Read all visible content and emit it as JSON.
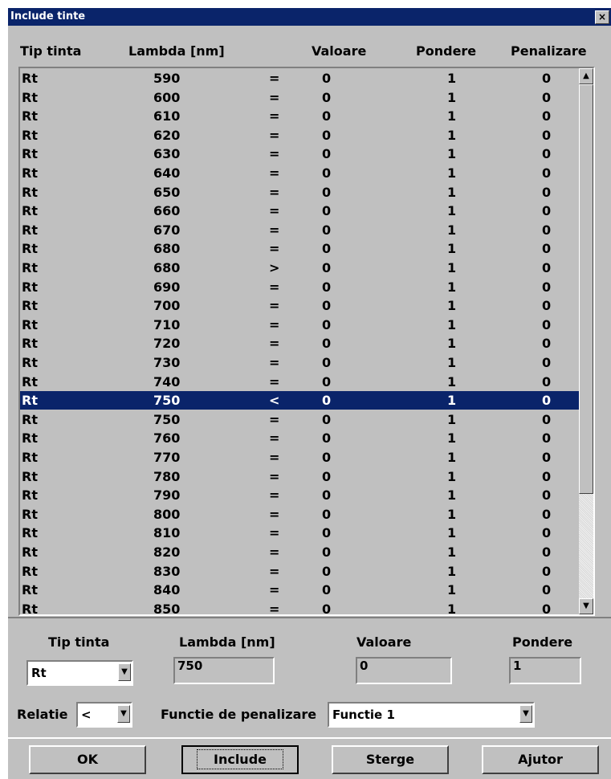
{
  "window": {
    "title": "Include tinte",
    "close_glyph": "×"
  },
  "table": {
    "headers": [
      "Tip tinta",
      "Lambda [nm]",
      "Valoare",
      "Pondere",
      "Penalizare"
    ],
    "rows": [
      [
        "Rt",
        "590",
        "=",
        "0",
        "1",
        "0"
      ],
      [
        "Rt",
        "600",
        "=",
        "0",
        "1",
        "0"
      ],
      [
        "Rt",
        "610",
        "=",
        "0",
        "1",
        "0"
      ],
      [
        "Rt",
        "620",
        "=",
        "0",
        "1",
        "0"
      ],
      [
        "Rt",
        "630",
        "=",
        "0",
        "1",
        "0"
      ],
      [
        "Rt",
        "640",
        "=",
        "0",
        "1",
        "0"
      ],
      [
        "Rt",
        "650",
        "=",
        "0",
        "1",
        "0"
      ],
      [
        "Rt",
        "660",
        "=",
        "0",
        "1",
        "0"
      ],
      [
        "Rt",
        "670",
        "=",
        "0",
        "1",
        "0"
      ],
      [
        "Rt",
        "680",
        "=",
        "0",
        "1",
        "0"
      ],
      [
        "Rt",
        "680",
        ">",
        "0",
        "1",
        "0"
      ],
      [
        "Rt",
        "690",
        "=",
        "0",
        "1",
        "0"
      ],
      [
        "Rt",
        "700",
        "=",
        "0",
        "1",
        "0"
      ],
      [
        "Rt",
        "710",
        "=",
        "0",
        "1",
        "0"
      ],
      [
        "Rt",
        "720",
        "=",
        "0",
        "1",
        "0"
      ],
      [
        "Rt",
        "730",
        "=",
        "0",
        "1",
        "0"
      ],
      [
        "Rt",
        "740",
        "=",
        "0",
        "1",
        "0"
      ],
      [
        "Rt",
        "750",
        "<",
        "0",
        "1",
        "0"
      ],
      [
        "Rt",
        "750",
        "=",
        "0",
        "1",
        "0"
      ],
      [
        "Rt",
        "760",
        "=",
        "0",
        "1",
        "0"
      ],
      [
        "Rt",
        "770",
        "=",
        "0",
        "1",
        "0"
      ],
      [
        "Rt",
        "780",
        "=",
        "0",
        "1",
        "0"
      ],
      [
        "Rt",
        "790",
        "=",
        "0",
        "1",
        "0"
      ],
      [
        "Rt",
        "800",
        "=",
        "0",
        "1",
        "0"
      ],
      [
        "Rt",
        "810",
        "=",
        "0",
        "1",
        "0"
      ],
      [
        "Rt",
        "820",
        "=",
        "0",
        "1",
        "0"
      ],
      [
        "Rt",
        "830",
        "=",
        "0",
        "1",
        "0"
      ],
      [
        "Rt",
        "840",
        "=",
        "0",
        "1",
        "0"
      ],
      [
        "Rt",
        "850",
        "=",
        "0",
        "1",
        "0"
      ]
    ],
    "selected_index": 17,
    "selection_color": "#0a246a"
  },
  "form": {
    "tip_tinta_label": "Tip tinta",
    "tip_tinta_value": "Rt",
    "lambda_label": "Lambda [nm]",
    "lambda_value": "750",
    "valoare_label": "Valoare",
    "valoare_value": "0",
    "pondere_label": "Pondere",
    "pondere_value": "1",
    "relatie_label": "Relatie",
    "relatie_value": "<",
    "functie_label": "Functie de penalizare",
    "functie_value": "Functie 1"
  },
  "buttons": {
    "ok": "OK",
    "include": "Include",
    "sterge": "Sterge",
    "ajutor": "Ajutor"
  },
  "icons": {
    "close": "close-icon",
    "dropdown": "chevron-down-icon",
    "scroll_up": "scroll-up-arrow-icon",
    "scroll_down": "scroll-down-arrow-icon"
  }
}
